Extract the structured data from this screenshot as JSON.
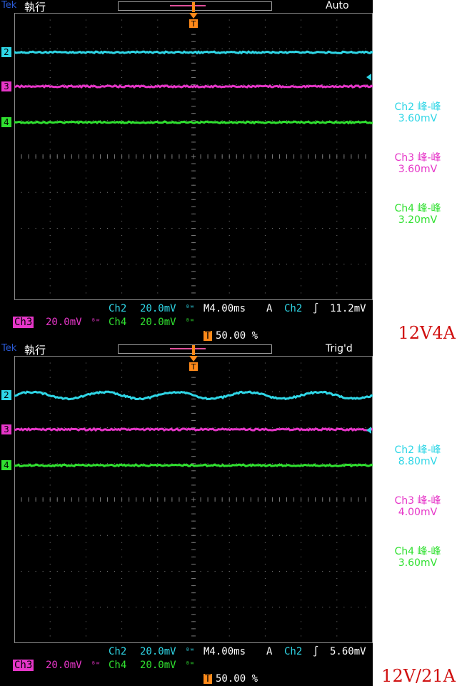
{
  "colors": {
    "ch2": "#2fd6e6",
    "ch3": "#e636c8",
    "ch4": "#30e030",
    "trigger": "#ff8a1a",
    "grid": "#7a7a7a",
    "caption": "#d01010"
  },
  "panels": [
    {
      "brand": "Tek",
      "brand_title": "執行",
      "mode": "Auto",
      "icons": {
        "trigger_marker": "trigger-position-icon",
        "level_marker": "trigger-level-arrow-icon"
      },
      "channel_markers": {
        "ch2": "2",
        "ch3": "3",
        "ch4": "4"
      },
      "traces": {
        "ch2": {
          "kind": "flat",
          "ripple_cycles": 0,
          "amplitude_div": 0.02
        },
        "ch3": {
          "kind": "flat",
          "ripple_cycles": 0,
          "amplitude_div": 0.02
        },
        "ch4": {
          "kind": "flat",
          "ripple_cycles": 0,
          "amplitude_div": 0.02
        }
      },
      "measurements": [
        {
          "name": "Ch2 峰-峰",
          "value": "3.60mV",
          "channel": "ch2"
        },
        {
          "name": "Ch3 峰-峰",
          "value": "3.60mV",
          "channel": "ch3"
        },
        {
          "name": "Ch4 峰-峰",
          "value": "3.20mV",
          "channel": "ch4"
        }
      ],
      "status": {
        "ch2_label": "Ch2",
        "ch2_scale": "20.0mV",
        "bw_glyph": "ᴮʷ",
        "timebase": "M4.00ms",
        "trig_mode": "A",
        "trig_source": "Ch2",
        "trig_slope": "∫",
        "trig_level": "11.2mV",
        "ch3_label": "Ch3",
        "ch3_scale": "20.0mV",
        "ch4_label": "Ch4",
        "ch4_scale": "20.0mV",
        "trig_pos_icon": "T",
        "trig_pos": "50.00 %"
      },
      "caption": "12V4A"
    },
    {
      "brand": "Tek",
      "brand_title": "執行",
      "mode": "Trig'd",
      "icons": {
        "trigger_marker": "trigger-position-icon",
        "level_marker": "trigger-level-arrow-icon"
      },
      "channel_markers": {
        "ch2": "2",
        "ch3": "3",
        "ch4": "4"
      },
      "traces": {
        "ch2": {
          "kind": "sine",
          "ripple_cycles": 5,
          "amplitude_div": 0.18
        },
        "ch3": {
          "kind": "flat",
          "ripple_cycles": 0,
          "amplitude_div": 0.02
        },
        "ch4": {
          "kind": "flat",
          "ripple_cycles": 0,
          "amplitude_div": 0.02
        }
      },
      "measurements": [
        {
          "name": "Ch2 峰-峰",
          "value": "8.80mV",
          "channel": "ch2"
        },
        {
          "name": "Ch3 峰-峰",
          "value": "4.00mV",
          "channel": "ch3"
        },
        {
          "name": "Ch4 峰-峰",
          "value": "3.60mV",
          "channel": "ch4"
        }
      ],
      "status": {
        "ch2_label": "Ch2",
        "ch2_scale": "20.0mV",
        "bw_glyph": "ᴮʷ",
        "timebase": "M4.00ms",
        "trig_mode": "A",
        "trig_source": "Ch2",
        "trig_slope": "∫",
        "trig_level": "5.60mV",
        "ch3_label": "Ch3",
        "ch3_scale": "20.0mV",
        "ch4_label": "Ch4",
        "ch4_scale": "20.0mV",
        "trig_pos_icon": "T",
        "trig_pos": "50.00 %"
      },
      "caption": "12V/21A"
    }
  ]
}
